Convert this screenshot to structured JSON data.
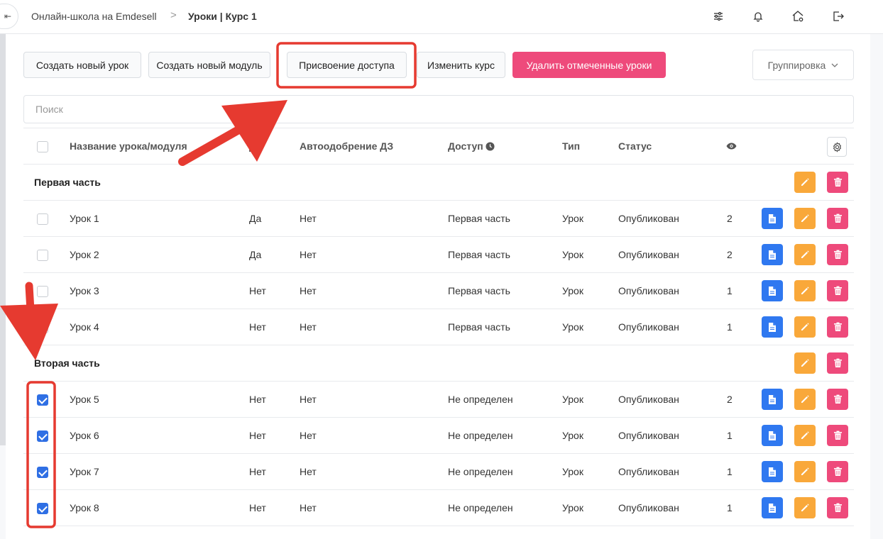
{
  "header": {
    "collapse_glyph": "⇤",
    "breadcrumb_root": "Онлайн-школа на Emdesell",
    "breadcrumb_sep": ">",
    "breadcrumb_current": "Уроки | Курс 1",
    "icons": [
      "sliders-icon",
      "bell-icon",
      "home-settings-icon",
      "logout-icon"
    ]
  },
  "toolbar": {
    "create_lesson": "Создать новый урок",
    "create_module": "Создать новый модуль",
    "assign_access": "Присвоение доступа",
    "edit_course": "Изменить курс",
    "delete_checked": "Удалить отмеченные уроки",
    "grouping": "Группировка"
  },
  "search": {
    "placeholder": "Поиск"
  },
  "table": {
    "columns": {
      "name": "Название урока/модуля",
      "hw": "ДЗ",
      "auto": "Автоодобрение ДЗ",
      "access": "Доступ",
      "type": "Тип",
      "status": "Статус"
    },
    "groups": [
      {
        "title": "Первая часть",
        "rows": [
          {
            "name": "Урок 1",
            "hw": "Да",
            "auto": "Нет",
            "access": "Первая часть",
            "type": "Урок",
            "status": "Опубликован",
            "views": "2",
            "checked": false
          },
          {
            "name": "Урок 2",
            "hw": "Да",
            "auto": "Нет",
            "access": "Первая часть",
            "type": "Урок",
            "status": "Опубликован",
            "views": "2",
            "checked": false
          },
          {
            "name": "Урок 3",
            "hw": "Нет",
            "auto": "Нет",
            "access": "Первая часть",
            "type": "Урок",
            "status": "Опубликован",
            "views": "1",
            "checked": false
          },
          {
            "name": "Урок 4",
            "hw": "Нет",
            "auto": "Нет",
            "access": "Первая часть",
            "type": "Урок",
            "status": "Опубликован",
            "views": "1",
            "checked": false
          }
        ]
      },
      {
        "title": "Вторая часть",
        "rows": [
          {
            "name": "Урок 5",
            "hw": "Нет",
            "auto": "Нет",
            "access": "Не определен",
            "type": "Урок",
            "status": "Опубликован",
            "views": "2",
            "checked": true
          },
          {
            "name": "Урок 6",
            "hw": "Нет",
            "auto": "Нет",
            "access": "Не определен",
            "type": "Урок",
            "status": "Опубликован",
            "views": "1",
            "checked": true
          },
          {
            "name": "Урок 7",
            "hw": "Нет",
            "auto": "Нет",
            "access": "Не определен",
            "type": "Урок",
            "status": "Опубликован",
            "views": "1",
            "checked": true
          },
          {
            "name": "Урок 8",
            "hw": "Нет",
            "auto": "Нет",
            "access": "Не определен",
            "type": "Урок",
            "status": "Опубликован",
            "views": "1",
            "checked": true
          }
        ]
      }
    ]
  },
  "colors": {
    "primary": "#2f78f0",
    "warning": "#f9a83a",
    "danger": "#ee4a7b",
    "annotation": "#e63a30"
  }
}
